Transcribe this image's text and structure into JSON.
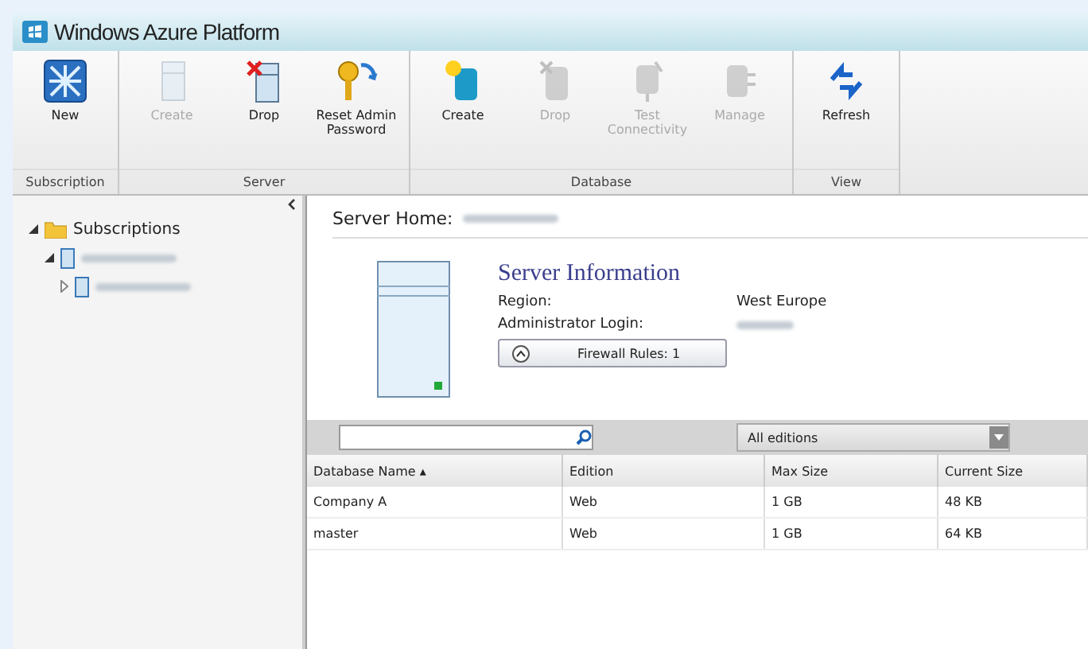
{
  "window": {
    "title": "Windows Azure Platform"
  },
  "ribbon": {
    "groups": [
      {
        "label": "Subscription",
        "buttons": [
          {
            "label": "New",
            "disabled": false
          }
        ]
      },
      {
        "label": "Server",
        "buttons": [
          {
            "label": "Create",
            "disabled": true
          },
          {
            "label": "Drop",
            "disabled": false
          },
          {
            "label": "Reset Admin Password",
            "disabled": false
          }
        ]
      },
      {
        "label": "Database",
        "buttons": [
          {
            "label": "Create",
            "disabled": false
          },
          {
            "label": "Drop",
            "disabled": true
          },
          {
            "label": "Test Connectivity",
            "disabled": true
          },
          {
            "label": "Manage",
            "disabled": true
          }
        ]
      },
      {
        "label": "View",
        "buttons": [
          {
            "label": "Refresh",
            "disabled": false
          }
        ]
      }
    ]
  },
  "tree": [
    {
      "label": "Subscriptions",
      "expanded": true,
      "children": [
        {
          "expanded": true,
          "children": [
            {
              "expanded": false
            }
          ]
        }
      ]
    }
  ],
  "server": {
    "home_label": "Server Home:",
    "info_title": "Server Information",
    "fields": [
      {
        "label": "Region:",
        "value": "West Europe"
      },
      {
        "label": "Administrator Login:"
      }
    ],
    "firewall_button": "Firewall Rules: 1"
  },
  "filter": {
    "edition": "All editions"
  },
  "table": {
    "columns": [
      "Database Name ▴",
      "Edition",
      "Max Size",
      "Current Size"
    ],
    "rows": [
      [
        "Company A",
        "Web",
        "1 GB",
        "48 KB"
      ],
      [
        "master",
        "Web",
        "1 GB",
        "64 KB"
      ]
    ]
  }
}
